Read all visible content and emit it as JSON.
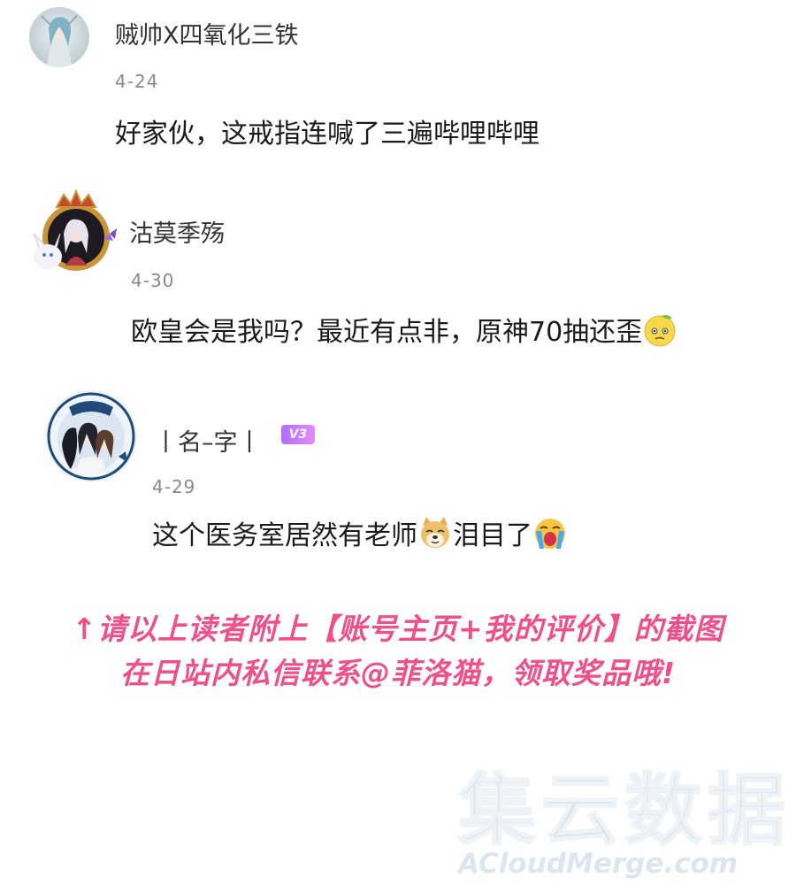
{
  "comments": [
    {
      "username": "贼帅X四氧化三铁",
      "date": "4-24",
      "content": "好家伙，这戒指连喊了三遍哔哩哔哩"
    },
    {
      "username": "沽莫季殇",
      "date": "4-30",
      "content": "欧皇会是我吗？最近有点非，原神70抽还歪",
      "emoji": "worried-face-emoji"
    },
    {
      "username": "丨名–字丨",
      "badge": "V3",
      "date": "4-29",
      "content_part1": "这个医务室居然有老师",
      "emoji1": "doge-emoji",
      "content_part2": "泪目了",
      "emoji2": "crying-emoji"
    }
  ],
  "promo": {
    "line1": "↑请以上读者附上【账号主页+我的评价】的截图",
    "line2": "在日站内私信联系@菲洛猫，领取奖品哦!"
  },
  "watermark": {
    "cn": "集云数据",
    "en": "ACloudMerge.com"
  }
}
